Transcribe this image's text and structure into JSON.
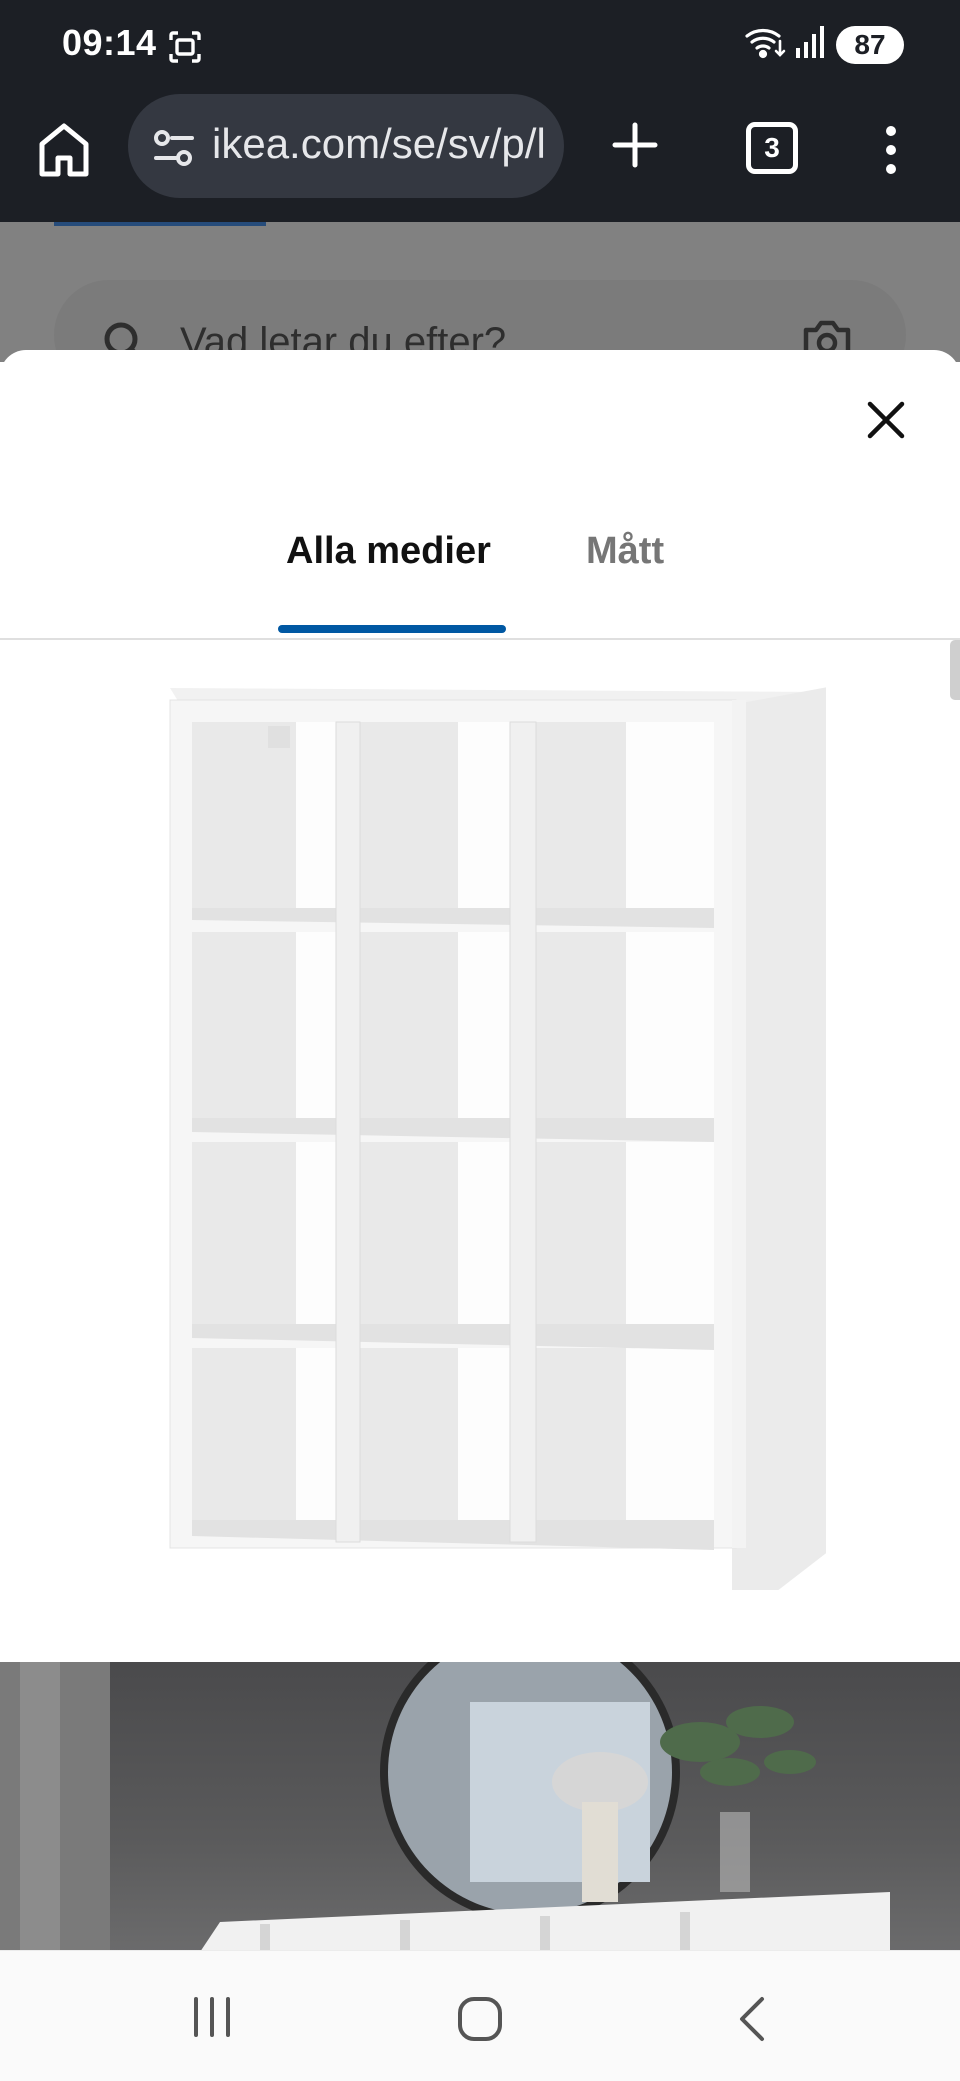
{
  "status_bar": {
    "time": "09:14",
    "battery": "87",
    "icons": [
      "screenshot-icon",
      "wifi-icon",
      "signal-icon",
      "battery-icon"
    ]
  },
  "browser": {
    "url": "ikea.com/se/sv/p/l",
    "tab_count": "3",
    "icons": [
      "home-icon",
      "site-settings-icon",
      "new-tab-icon",
      "tab-switcher-icon",
      "more-menu-icon"
    ]
  },
  "background_page": {
    "search_placeholder": "Vad letar du efter?",
    "icons": [
      "search-icon",
      "camera-icon"
    ]
  },
  "media_modal": {
    "tabs": [
      {
        "label": "Alla medier",
        "active": true
      },
      {
        "label": "Mått",
        "active": false
      }
    ],
    "accent_color": "#0058a3",
    "images": [
      "product-shelf-image",
      "lifestyle-room-image"
    ]
  },
  "nav_bar": {
    "buttons": [
      "recents-button",
      "home-button",
      "back-button"
    ]
  }
}
